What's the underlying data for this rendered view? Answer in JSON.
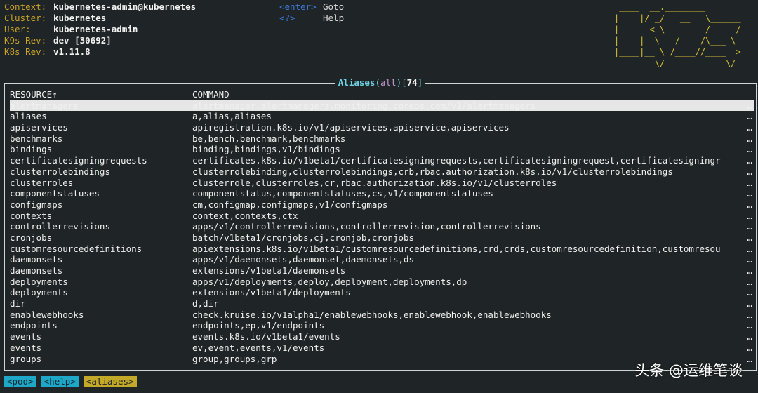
{
  "header": {
    "rows": [
      {
        "key": "Context:",
        "value": "kubernetes-admin@kubernetes"
      },
      {
        "key": "Cluster:",
        "value": "kubernetes"
      },
      {
        "key": "User:",
        "value": "kubernetes-admin"
      },
      {
        "key": "K9s Rev:",
        "value": "dev [30692]"
      },
      {
        "key": "K8s Rev:",
        "value": "v1.11.8"
      }
    ]
  },
  "keybindings": [
    {
      "key": "<enter>",
      "desc": "Goto"
    },
    {
      "key": "<?>",
      "desc": "Help"
    }
  ],
  "logo": " ____  __.________\n|    |/ _/   __   \\______\n|      < \\____    /  ___/\n|    |  \\   /    /\\___ \\\n|____|__ \\ /____//____  >\n        \\/            \\/",
  "view": {
    "title": "Aliases",
    "namespace": "all",
    "count": "74"
  },
  "table": {
    "headers": {
      "resource": "RESOURCE↑",
      "command": "COMMAND"
    },
    "ellipsis": "…",
    "rows": [
      {
        "resource": "alertmanagers",
        "command": "alertmanager,alertmanagers,monitoring.coreos.com/v1/alertmanagers",
        "selected": true
      },
      {
        "resource": "aliases",
        "command": "a,alias,aliases"
      },
      {
        "resource": "apiservices",
        "command": "apiregistration.k8s.io/v1/apiservices,apiservice,apiservices"
      },
      {
        "resource": "benchmarks",
        "command": "be,bench,benchmark,benchmarks"
      },
      {
        "resource": "bindings",
        "command": "binding,bindings,v1/bindings"
      },
      {
        "resource": "certificatesigningrequests",
        "command": "certificates.k8s.io/v1beta1/certificatesigningrequests,certificatesigningrequest,certificatesigningr"
      },
      {
        "resource": "clusterrolebindings",
        "command": "clusterrolebinding,clusterrolebindings,crb,rbac.authorization.k8s.io/v1/clusterrolebindings"
      },
      {
        "resource": "clusterroles",
        "command": "clusterrole,clusterroles,cr,rbac.authorization.k8s.io/v1/clusterroles"
      },
      {
        "resource": "componentstatuses",
        "command": "componentstatus,componentstatuses,cs,v1/componentstatuses"
      },
      {
        "resource": "configmaps",
        "command": "cm,configmap,configmaps,v1/configmaps"
      },
      {
        "resource": "contexts",
        "command": "context,contexts,ctx"
      },
      {
        "resource": "controllerrevisions",
        "command": "apps/v1/controllerrevisions,controllerrevision,controllerrevisions"
      },
      {
        "resource": "cronjobs",
        "command": "batch/v1beta1/cronjobs,cj,cronjob,cronjobs"
      },
      {
        "resource": "customresourcedefinitions",
        "command": "apiextensions.k8s.io/v1beta1/customresourcedefinitions,crd,crds,customresourcedefinition,customresou"
      },
      {
        "resource": "daemonsets",
        "command": "apps/v1/daemonsets,daemonset,daemonsets,ds"
      },
      {
        "resource": "daemonsets",
        "command": "extensions/v1beta1/daemonsets"
      },
      {
        "resource": "deployments",
        "command": "apps/v1/deployments,deploy,deployment,deployments,dp"
      },
      {
        "resource": "deployments",
        "command": "extensions/v1beta1/deployments"
      },
      {
        "resource": "dir",
        "command": "d,dir"
      },
      {
        "resource": "enablewebhooks",
        "command": "check.kruise.io/v1alpha1/enablewebhooks,enablewebhook,enablewebhooks"
      },
      {
        "resource": "endpoints",
        "command": "endpoints,ep,v1/endpoints"
      },
      {
        "resource": "events",
        "command": "events.k8s.io/v1beta1/events"
      },
      {
        "resource": "events",
        "command": "ev,event,events,v1/events"
      },
      {
        "resource": "groups",
        "command": "group,groups,grp"
      }
    ]
  },
  "crumbs": [
    {
      "label": "<pod>",
      "kind": "pod"
    },
    {
      "label": "<help>",
      "kind": "help"
    },
    {
      "label": "<aliases>",
      "kind": "aliases"
    }
  ],
  "watermark": "头条 @运维笔谈",
  "colors": {
    "background": "#1f2526",
    "header_key": "#c9a227",
    "keybinding": "#3d78d8",
    "logo": "#d8c23a",
    "title": "#6fd3e6",
    "namespace": "#c59bd6",
    "crumb_cyan": "#1ea7c7",
    "crumb_yellow": "#c2a928"
  }
}
